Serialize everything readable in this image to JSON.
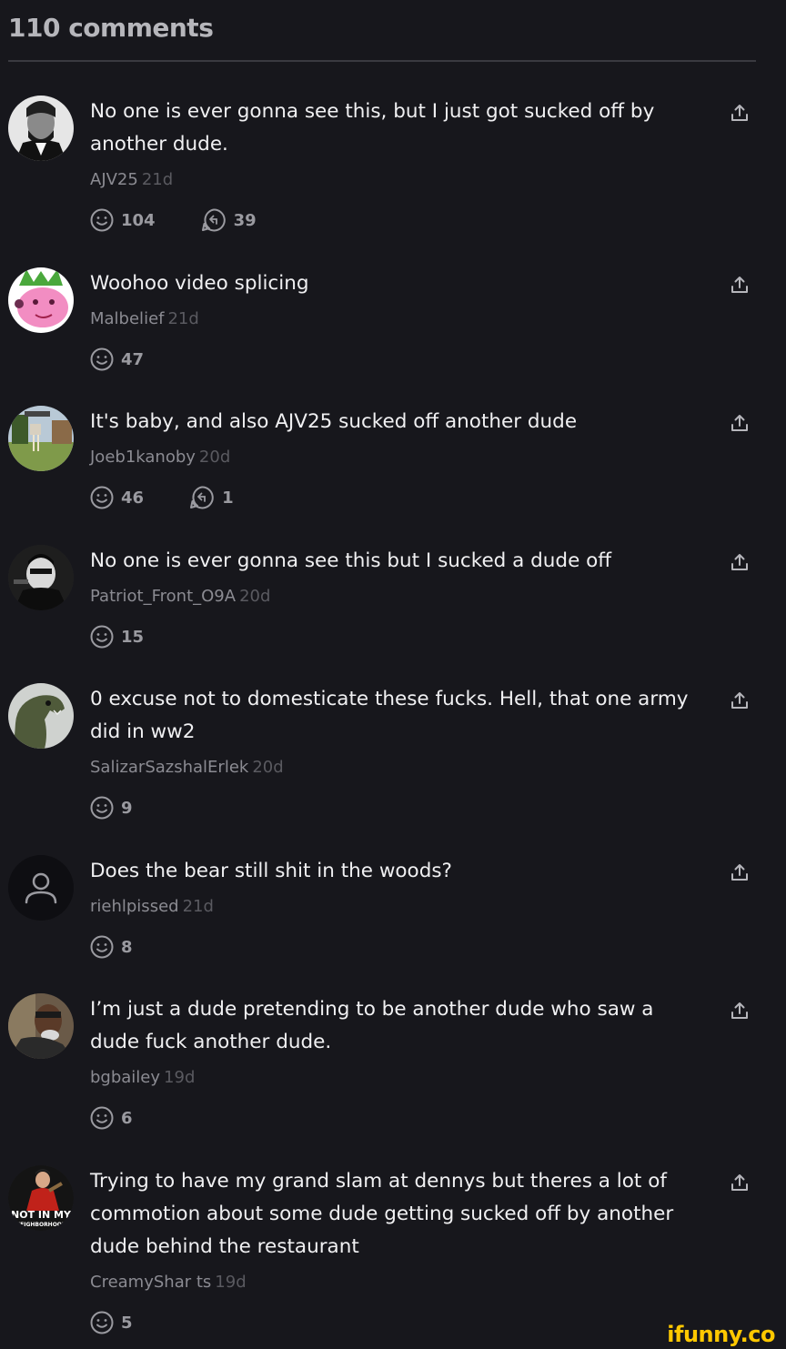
{
  "header": {
    "title": "110 comments"
  },
  "colors": {
    "background": "#17171c",
    "text": "#f0f0f2",
    "username": "#8b8b92",
    "timestamp": "#5a5a60",
    "watermark": "#ffc800"
  },
  "comments": [
    {
      "text": "No one is ever gonna see this, but I just got sucked off by another dude.",
      "user": "AJV25",
      "time": "21d",
      "smiles": "104",
      "replies": "39",
      "avatar": "lincoln-portrait"
    },
    {
      "text": "Woohoo video splicing",
      "user": "Malbelief",
      "time": "21d",
      "smiles": "47",
      "replies": "",
      "avatar": "pink-pig-character"
    },
    {
      "text": "It's baby, and also AJV25 sucked off another dude",
      "user": "Joeb1kanoby",
      "time": "20d",
      "smiles": "46",
      "replies": "1",
      "avatar": "outdoor-scene"
    },
    {
      "text": "No one is ever gonna see this but I sucked a dude off",
      "user": "Patriot_Front_O9A",
      "time": "20d",
      "smiles": "15",
      "replies": "",
      "avatar": "masked-figure"
    },
    {
      "text": "0 excuse not to domesticate these fucks. Hell, that one army did in ww2",
      "user": "SalizarSazshalErlek",
      "time": "20d",
      "smiles": "9",
      "replies": "",
      "avatar": "dinosaur"
    },
    {
      "text": "Does the bear still shit in the woods?",
      "user": "riehlpissed",
      "time": "21d",
      "smiles": "8",
      "replies": "",
      "avatar": "default-user"
    },
    {
      "text": "I’m just a dude pretending to be another dude who saw a dude fuck another dude.",
      "user": "bgbailey",
      "time": "19d",
      "smiles": "6",
      "replies": "",
      "avatar": "man-photo"
    },
    {
      "text": "Trying to have my grand slam at dennys but theres a lot of commotion about some dude getting sucked off by another dude behind the restaurant",
      "user": "CreamyShar ts",
      "time": "19d",
      "smiles": "5",
      "replies": "",
      "avatar": "not-in-my-neighborhood"
    }
  ],
  "avatar_text": {
    "line1": "NOT IN MY",
    "line2": "NEIGHBORHOOD"
  },
  "watermark": "ifunny.co"
}
